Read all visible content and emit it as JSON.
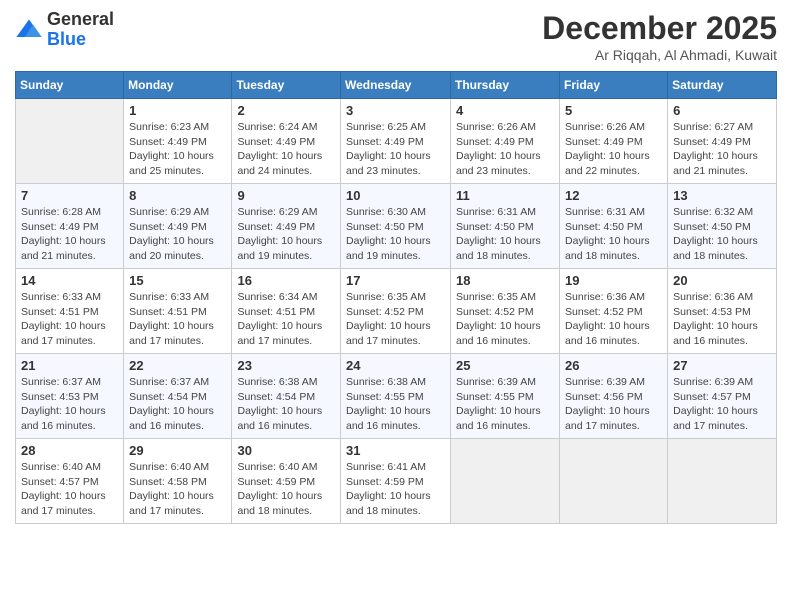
{
  "logo": {
    "general": "General",
    "blue": "Blue"
  },
  "header": {
    "title": "December 2025",
    "location": "Ar Riqqah, Al Ahmadi, Kuwait"
  },
  "weekdays": [
    "Sunday",
    "Monday",
    "Tuesday",
    "Wednesday",
    "Thursday",
    "Friday",
    "Saturday"
  ],
  "weeks": [
    [
      {
        "day": "",
        "info": ""
      },
      {
        "day": "1",
        "info": "Sunrise: 6:23 AM\nSunset: 4:49 PM\nDaylight: 10 hours\nand 25 minutes."
      },
      {
        "day": "2",
        "info": "Sunrise: 6:24 AM\nSunset: 4:49 PM\nDaylight: 10 hours\nand 24 minutes."
      },
      {
        "day": "3",
        "info": "Sunrise: 6:25 AM\nSunset: 4:49 PM\nDaylight: 10 hours\nand 23 minutes."
      },
      {
        "day": "4",
        "info": "Sunrise: 6:26 AM\nSunset: 4:49 PM\nDaylight: 10 hours\nand 23 minutes."
      },
      {
        "day": "5",
        "info": "Sunrise: 6:26 AM\nSunset: 4:49 PM\nDaylight: 10 hours\nand 22 minutes."
      },
      {
        "day": "6",
        "info": "Sunrise: 6:27 AM\nSunset: 4:49 PM\nDaylight: 10 hours\nand 21 minutes."
      }
    ],
    [
      {
        "day": "7",
        "info": "Sunrise: 6:28 AM\nSunset: 4:49 PM\nDaylight: 10 hours\nand 21 minutes."
      },
      {
        "day": "8",
        "info": "Sunrise: 6:29 AM\nSunset: 4:49 PM\nDaylight: 10 hours\nand 20 minutes."
      },
      {
        "day": "9",
        "info": "Sunrise: 6:29 AM\nSunset: 4:49 PM\nDaylight: 10 hours\nand 19 minutes."
      },
      {
        "day": "10",
        "info": "Sunrise: 6:30 AM\nSunset: 4:50 PM\nDaylight: 10 hours\nand 19 minutes."
      },
      {
        "day": "11",
        "info": "Sunrise: 6:31 AM\nSunset: 4:50 PM\nDaylight: 10 hours\nand 18 minutes."
      },
      {
        "day": "12",
        "info": "Sunrise: 6:31 AM\nSunset: 4:50 PM\nDaylight: 10 hours\nand 18 minutes."
      },
      {
        "day": "13",
        "info": "Sunrise: 6:32 AM\nSunset: 4:50 PM\nDaylight: 10 hours\nand 18 minutes."
      }
    ],
    [
      {
        "day": "14",
        "info": "Sunrise: 6:33 AM\nSunset: 4:51 PM\nDaylight: 10 hours\nand 17 minutes."
      },
      {
        "day": "15",
        "info": "Sunrise: 6:33 AM\nSunset: 4:51 PM\nDaylight: 10 hours\nand 17 minutes."
      },
      {
        "day": "16",
        "info": "Sunrise: 6:34 AM\nSunset: 4:51 PM\nDaylight: 10 hours\nand 17 minutes."
      },
      {
        "day": "17",
        "info": "Sunrise: 6:35 AM\nSunset: 4:52 PM\nDaylight: 10 hours\nand 17 minutes."
      },
      {
        "day": "18",
        "info": "Sunrise: 6:35 AM\nSunset: 4:52 PM\nDaylight: 10 hours\nand 16 minutes."
      },
      {
        "day": "19",
        "info": "Sunrise: 6:36 AM\nSunset: 4:52 PM\nDaylight: 10 hours\nand 16 minutes."
      },
      {
        "day": "20",
        "info": "Sunrise: 6:36 AM\nSunset: 4:53 PM\nDaylight: 10 hours\nand 16 minutes."
      }
    ],
    [
      {
        "day": "21",
        "info": "Sunrise: 6:37 AM\nSunset: 4:53 PM\nDaylight: 10 hours\nand 16 minutes."
      },
      {
        "day": "22",
        "info": "Sunrise: 6:37 AM\nSunset: 4:54 PM\nDaylight: 10 hours\nand 16 minutes."
      },
      {
        "day": "23",
        "info": "Sunrise: 6:38 AM\nSunset: 4:54 PM\nDaylight: 10 hours\nand 16 minutes."
      },
      {
        "day": "24",
        "info": "Sunrise: 6:38 AM\nSunset: 4:55 PM\nDaylight: 10 hours\nand 16 minutes."
      },
      {
        "day": "25",
        "info": "Sunrise: 6:39 AM\nSunset: 4:55 PM\nDaylight: 10 hours\nand 16 minutes."
      },
      {
        "day": "26",
        "info": "Sunrise: 6:39 AM\nSunset: 4:56 PM\nDaylight: 10 hours\nand 17 minutes."
      },
      {
        "day": "27",
        "info": "Sunrise: 6:39 AM\nSunset: 4:57 PM\nDaylight: 10 hours\nand 17 minutes."
      }
    ],
    [
      {
        "day": "28",
        "info": "Sunrise: 6:40 AM\nSunset: 4:57 PM\nDaylight: 10 hours\nand 17 minutes."
      },
      {
        "day": "29",
        "info": "Sunrise: 6:40 AM\nSunset: 4:58 PM\nDaylight: 10 hours\nand 17 minutes."
      },
      {
        "day": "30",
        "info": "Sunrise: 6:40 AM\nSunset: 4:59 PM\nDaylight: 10 hours\nand 18 minutes."
      },
      {
        "day": "31",
        "info": "Sunrise: 6:41 AM\nSunset: 4:59 PM\nDaylight: 10 hours\nand 18 minutes."
      },
      {
        "day": "",
        "info": ""
      },
      {
        "day": "",
        "info": ""
      },
      {
        "day": "",
        "info": ""
      }
    ]
  ]
}
